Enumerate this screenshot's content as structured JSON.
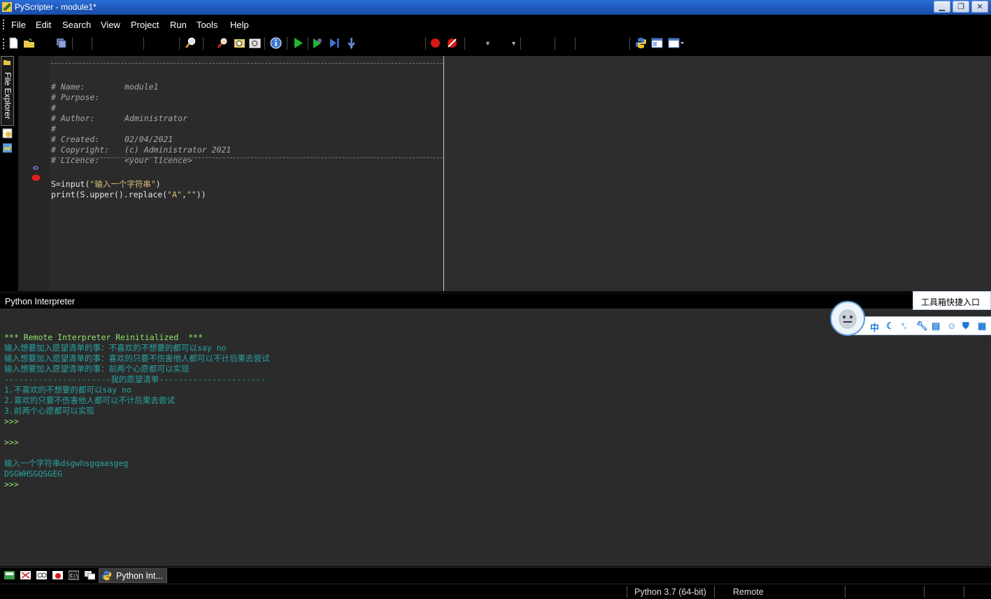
{
  "window": {
    "title": "PyScripter - module1*",
    "controls": {
      "minimize": "▁",
      "restore": "❐",
      "close": "✕"
    }
  },
  "menu": [
    "File",
    "Edit",
    "Search",
    "View",
    "Project",
    "Run",
    "Tools",
    "Help"
  ],
  "left_dock": {
    "file_explorer_tab": "File Explorer"
  },
  "editor": {
    "header": {
      "dash_line": "#-----------------------------------------------------------------------------",
      "name_label": "# Name:",
      "name_value": "module1",
      "purpose_label": "# Purpose:",
      "blank1": "#",
      "author_label": "# Author:",
      "author_value": "Administrator",
      "blank2": "#",
      "created_label": "# Created:",
      "created_value": "02/04/2021",
      "copyright_label": "# Copyright:",
      "copyright_value": "(c) Administrator 2021",
      "licence_label": "# Licence:",
      "licence_value": "<your licence>"
    },
    "code": {
      "line1_a": "S=input(",
      "line1_str": "\"输入一个字符串\"",
      "line1_b": ")",
      "line2_a": "print(S.upper().replace(",
      "line2_s1": "\"A\"",
      "line2_comma": ",",
      "line2_s2": "\"\"",
      "line2_b": "))"
    },
    "breakpoint_color": "#e02020"
  },
  "interpreter": {
    "title": "Python Interpreter",
    "lines": {
      "reinit": "*** Remote Interpreter Reinitialized  ***",
      "o1": "输入想要加入愿望清单的事：不喜欢的不想要的都可以say no",
      "o2": "输入想要加入愿望清单的事：喜欢的只要不伤害他人都可以不计后果去尝试",
      "o3": "输入想要加入愿望清单的事：前两个心愿都可以实现",
      "o4": "----------------------我的愿望清单----------------------",
      "o5": "1.不喜欢的不想要的都可以say no",
      "o6": "2.喜欢的只要不伤害他人都可以不计后果去尝试",
      "o7": "3.前两个心愿都可以实现",
      "p1": ">>>",
      "p2": ">>>",
      "o8": "输入一个字符串dsgwhsgqaasgeg",
      "o9": "DSGWHSGQSGEG",
      "p3": ">>>"
    }
  },
  "bottom_tabs": {
    "active_label": "Python Int..."
  },
  "status": {
    "python_version": "Python 3.7 (64-bit)",
    "engine": "Remote"
  },
  "ime": {
    "tooltip": "工具箱快捷入口",
    "mode_char": "中",
    "icons": [
      "moon-icon",
      "punct-icon",
      "wrench-icon",
      "clipboard-icon",
      "smiley-icon",
      "shirt-icon",
      "grid-icon"
    ]
  }
}
